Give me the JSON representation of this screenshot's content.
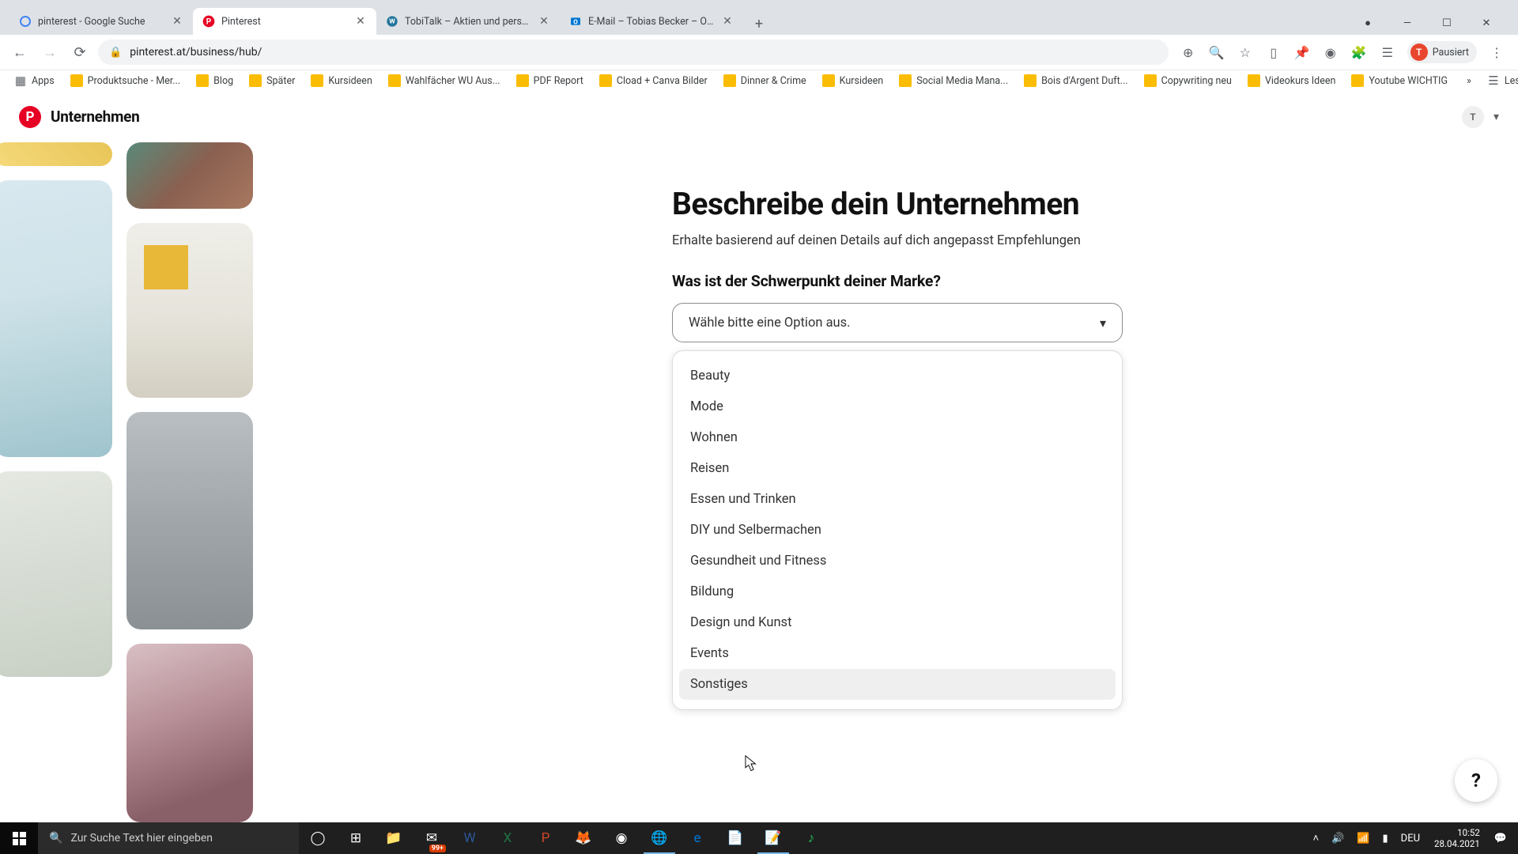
{
  "browser": {
    "tabs": [
      {
        "title": "pinterest - Google Suche",
        "favicon": "google"
      },
      {
        "title": "Pinterest",
        "favicon": "pinterest",
        "active": true
      },
      {
        "title": "TobiTalk – Aktien und persönlich...",
        "favicon": "wordpress"
      },
      {
        "title": "E-Mail – Tobias Becker – Outlook",
        "favicon": "outlook"
      }
    ],
    "address": "pinterest.at/business/hub/",
    "profile_status": "Pausiert",
    "profile_initial": "T"
  },
  "bookmarks": [
    {
      "label": "Apps",
      "kind": "apps"
    },
    {
      "label": "Produktsuche - Mer..."
    },
    {
      "label": "Blog"
    },
    {
      "label": "Später"
    },
    {
      "label": "Kursideen"
    },
    {
      "label": "Wahlfächer WU Aus..."
    },
    {
      "label": "PDF Report"
    },
    {
      "label": "Cload + Canva Bilder"
    },
    {
      "label": "Dinner & Crime"
    },
    {
      "label": "Kursideen"
    },
    {
      "label": "Social Media Mana..."
    },
    {
      "label": "Bois d'Argent Duft..."
    },
    {
      "label": "Copywriting neu"
    },
    {
      "label": "Videokurs Ideen"
    },
    {
      "label": "Youtube WICHTIG"
    }
  ],
  "read_list": "Leseliste",
  "header": {
    "brand": "Unternehmen",
    "user_initial": "T"
  },
  "form": {
    "heading": "Beschreibe dein Unternehmen",
    "subheading": "Erhalte basierend auf deinen Details auf dich angepasst Empfehlungen",
    "question": "Was ist der Schwerpunkt deiner Marke?",
    "select_placeholder": "Wähle bitte eine Option aus.",
    "options": [
      "Beauty",
      "Mode",
      "Wohnen",
      "Reisen",
      "Essen und Trinken",
      "DIY und Selbermachen",
      "Gesundheit und Fitness",
      "Bildung",
      "Design und Kunst",
      "Events",
      "Sonstiges"
    ],
    "hovered_index": 10
  },
  "help_label": "?",
  "taskbar": {
    "search_placeholder": "Zur Suche Text hier eingeben",
    "lang": "DEU",
    "time": "10:52",
    "date": "28.04.2021",
    "mail_badge": "99+"
  }
}
